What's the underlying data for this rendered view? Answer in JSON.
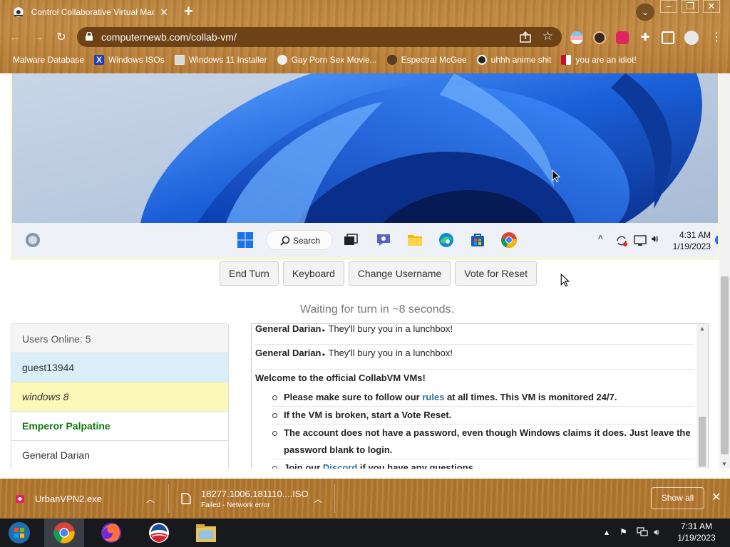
{
  "browser": {
    "tab_title": "Control Collaborative Virtual Machines",
    "url": "computernewb.com/collab-vm/",
    "bookmarks": [
      {
        "label": "Malware Database"
      },
      {
        "label": "Windows ISOs"
      },
      {
        "label": "Windows 11 Installer"
      },
      {
        "label": "Gay Porn Sex Movie..."
      },
      {
        "label": "Espectral McGee"
      },
      {
        "label": "uhhh anime shit"
      },
      {
        "label": "you are an idiot!"
      }
    ]
  },
  "vm": {
    "taskbar_search": "Search",
    "clock_time": "4:31 AM",
    "clock_date": "1/19/2023"
  },
  "controls": {
    "end_turn": "End Turn",
    "keyboard": "Keyboard",
    "change_username": "Change Username",
    "vote_reset": "Vote for Reset"
  },
  "status": {
    "waiting": "Waiting for turn in ~8 seconds."
  },
  "users": {
    "header": "Users Online: 5",
    "list": [
      "guest13944",
      "windows 8",
      "Emperor Palpatine",
      "General Darian"
    ]
  },
  "chat": {
    "messages": [
      {
        "user": "General Darian",
        "text": "They'll bury you in a lunchbox!"
      },
      {
        "user": "General Darian",
        "text": "They'll bury you in a lunchbox!"
      }
    ],
    "welcome_title": "Welcome to the official CollabVM VMs!",
    "rules_pre": "Please make sure to follow our ",
    "rules_link": "rules",
    "rules_post": " at all times. This VM is monitored 24/7.",
    "broken": "If the VM is broken, start a Vote Reset.",
    "password": "The account does not have a password, even though Windows claims it does. Just leave the password blank to login.",
    "discord_pre": "Join our ",
    "discord_link": "Discord",
    "discord_post": " if you have any questions."
  },
  "downloads": [
    {
      "name": "UrbanVPN2.exe",
      "status": ""
    },
    {
      "name": "18277.1006.181110....ISO",
      "status": "Failed - Network error"
    }
  ],
  "download_bar": {
    "show_all": "Show all"
  },
  "host": {
    "clock_time": "7:31 AM",
    "clock_date": "1/19/2023"
  },
  "colors": {
    "chrome_wood": "#b8823a",
    "omnibox": "#6d4217",
    "user_highlight_blue": "#d9eef7",
    "user_highlight_yellow": "#fcf8b7",
    "user_admin_green": "#0f7a0f",
    "link": "#2e6da4",
    "win11_blue": "#1a5fd8"
  }
}
